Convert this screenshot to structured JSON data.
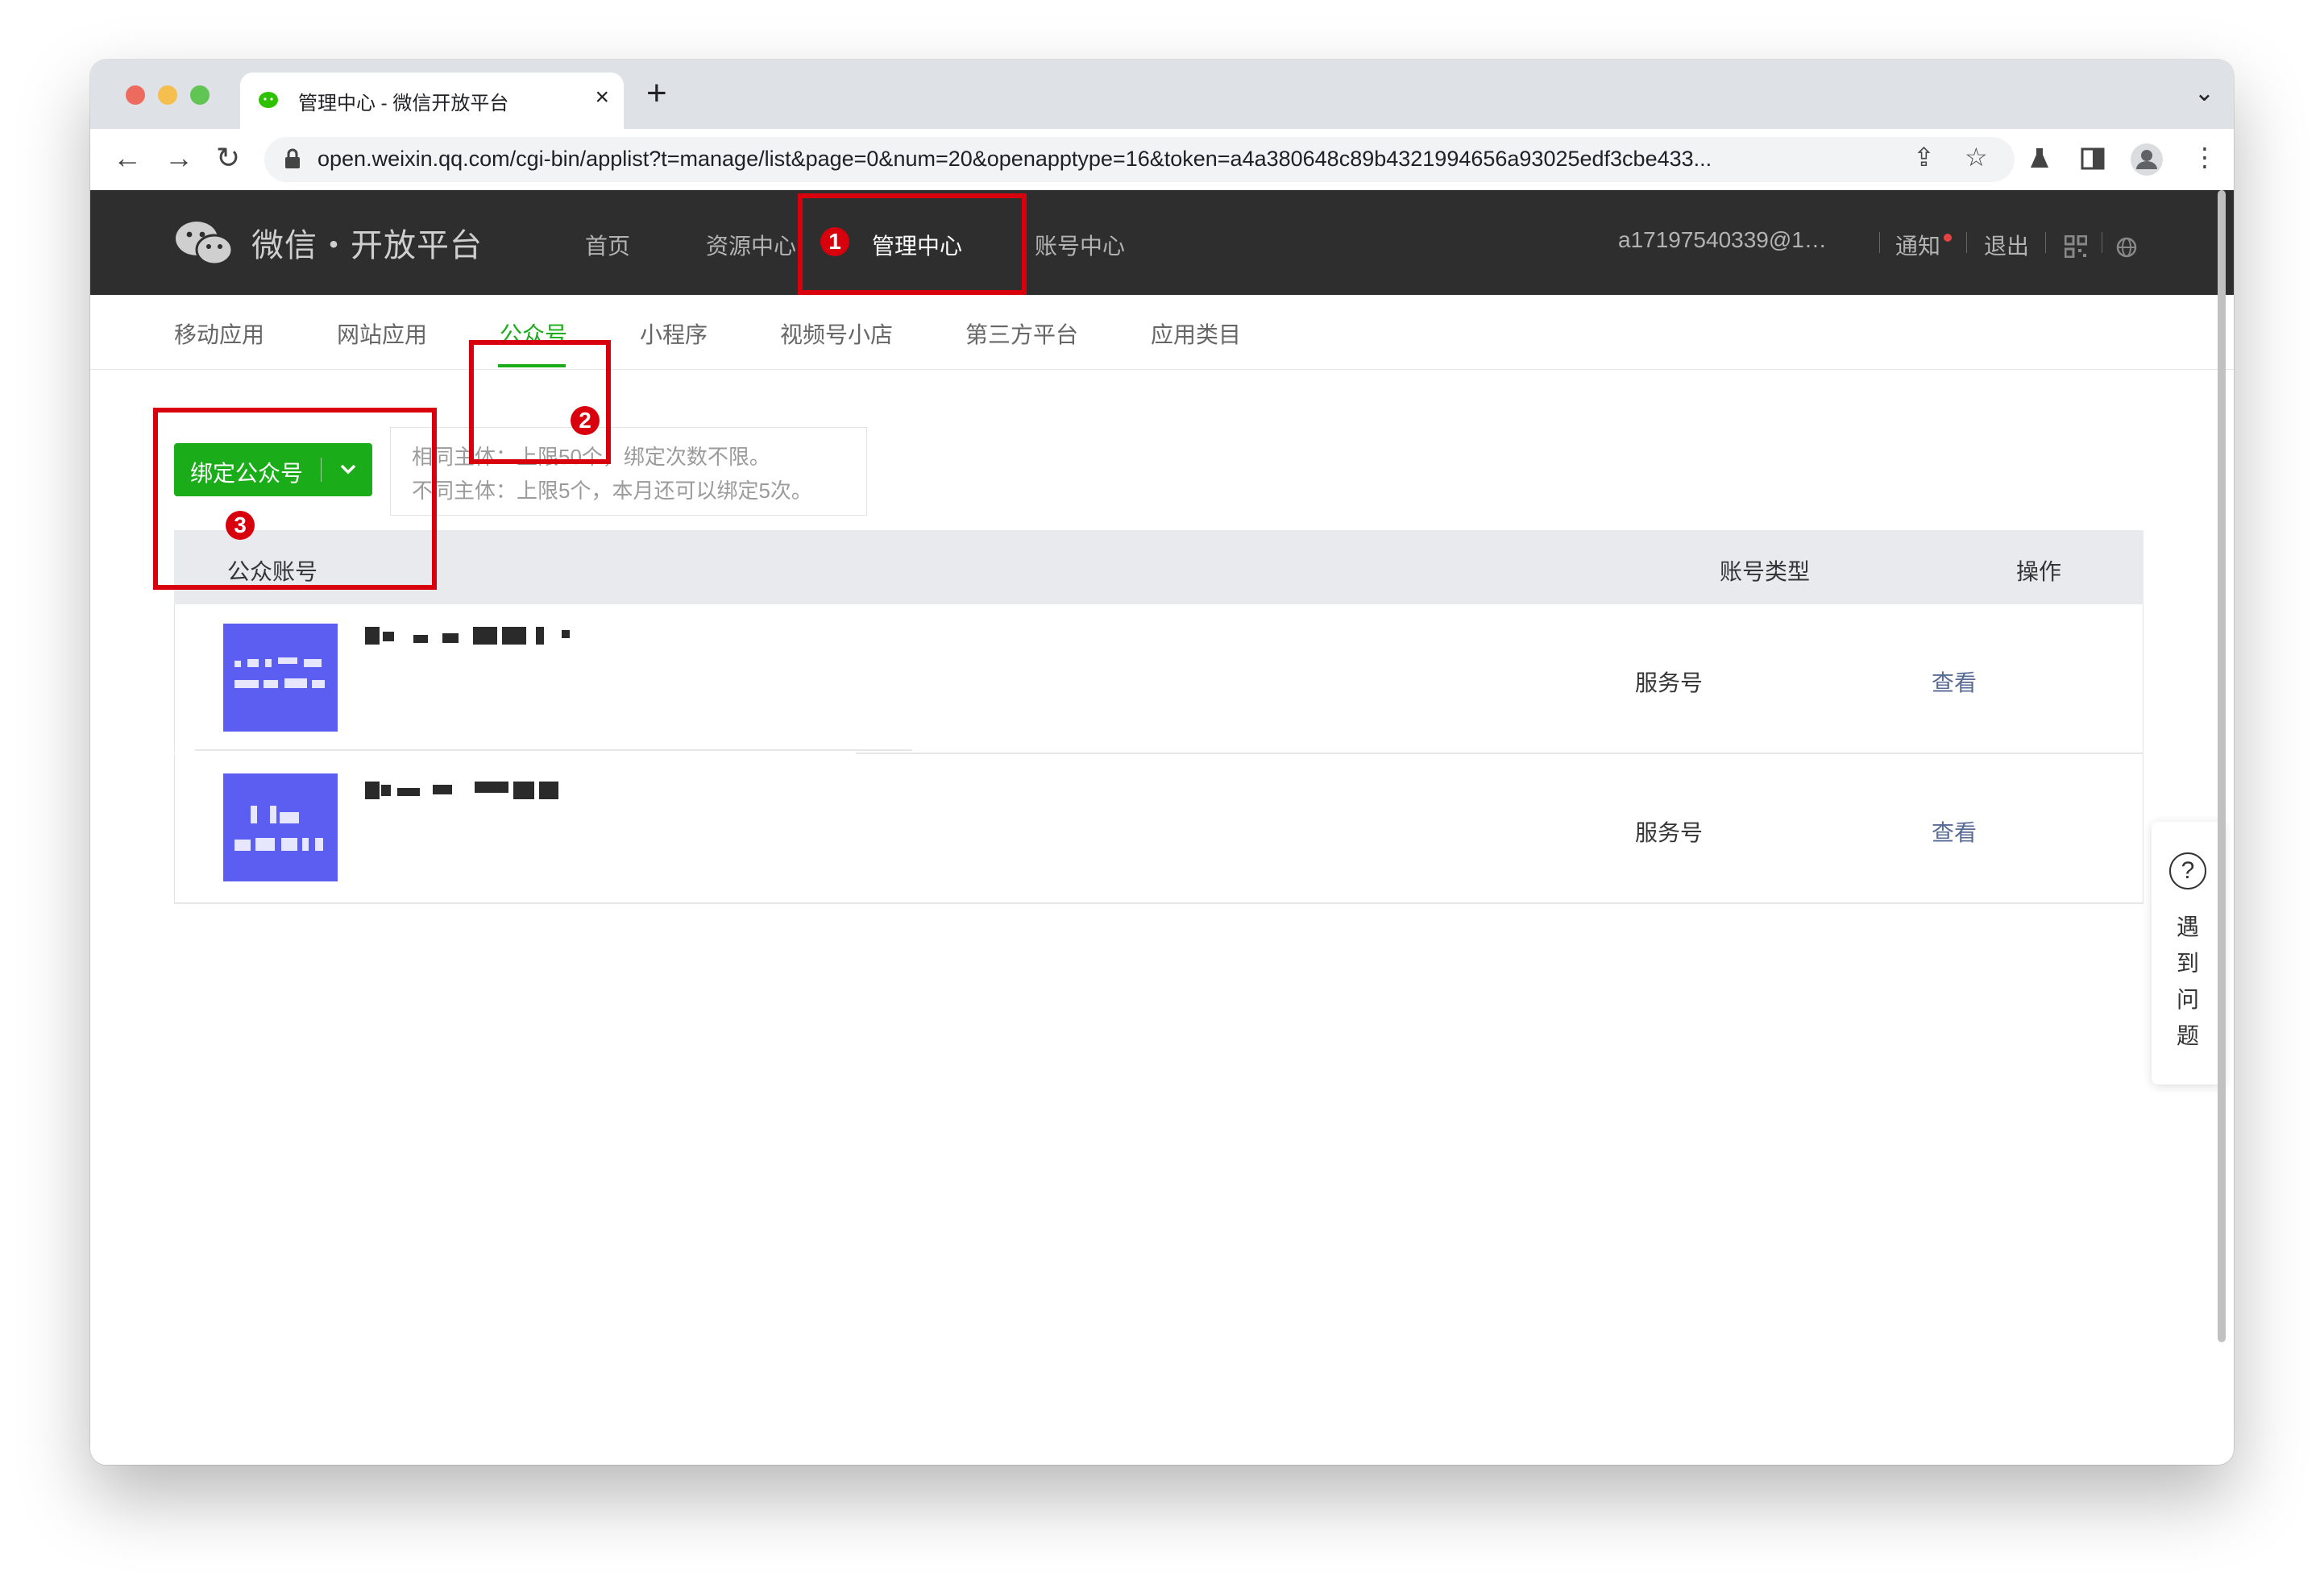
{
  "browser": {
    "tab_title": "管理中心 - 微信开放平台",
    "tab_close": "×",
    "new_tab": "+",
    "tab_menu": "⌄",
    "url": "open.weixin.qq.com/cgi-bin/applist?t=manage/list&page=0&num=20&openapptype=16&token=a4a380648c89b4321994656a93025edf3cbe433...",
    "back": "←",
    "forward": "→",
    "reload": "↻",
    "share": "⇪",
    "star": "☆",
    "menu": "⋮"
  },
  "header": {
    "logo_text": "微信・开放平台",
    "nav": [
      "首页",
      "资源中心",
      "管理中心",
      "账号中心"
    ],
    "active_nav": "管理中心",
    "user": "a17197540339@1…",
    "notify": "通知",
    "logout": "退出"
  },
  "subnav": {
    "items": [
      "移动应用",
      "网站应用",
      "公众号",
      "小程序",
      "视频号小店",
      "第三方平台",
      "应用类目"
    ],
    "active": "公众号"
  },
  "bind": {
    "button_label": "绑定公众号",
    "tip_line1": "相同主体：上限50个，绑定次数不限。",
    "tip_line2": "不同主体：上限5个，本月还可以绑定5次。"
  },
  "table": {
    "headers": [
      "公众账号",
      "账号类型",
      "操作"
    ],
    "rows": [
      {
        "type": "服务号",
        "action": "查看"
      },
      {
        "type": "服务号",
        "action": "查看"
      }
    ]
  },
  "help": {
    "text": "遇到问题"
  },
  "annotations": [
    "1",
    "2",
    "3"
  ],
  "colors": {
    "brand_green": "#1aad19",
    "link": "#576b95",
    "annotation_red": "#d8000c",
    "header_bg": "#2e2e2e"
  }
}
